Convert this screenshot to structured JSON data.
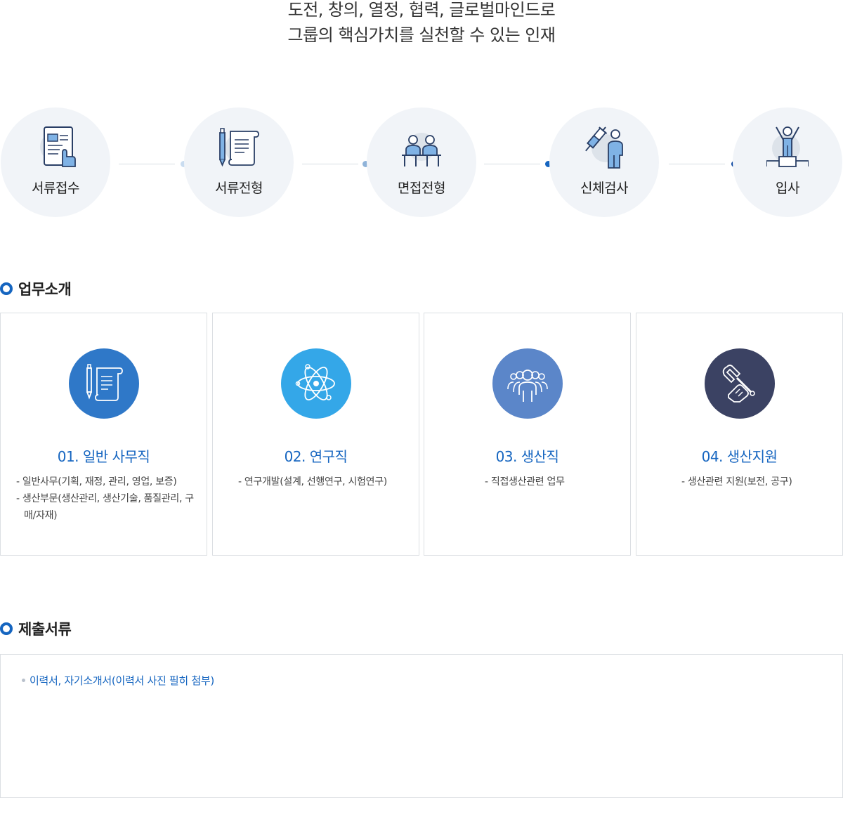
{
  "intro": {
    "line1": "도전, 창의, 열정, 협력, 글로벌마인드로",
    "line2": "그룹의 핵심가치를 실천할 수 있는 인재"
  },
  "process": {
    "steps": [
      {
        "label": "서류접수",
        "icon": "document-touch-icon"
      },
      {
        "label": "서류전형",
        "icon": "pen-scroll-icon"
      },
      {
        "label": "면접전형",
        "icon": "interview-icon"
      },
      {
        "label": "신체검사",
        "icon": "syringe-person-icon"
      },
      {
        "label": "입사",
        "icon": "podium-winner-icon"
      }
    ],
    "colors": {
      "dot1": "#c9dcf0",
      "dot2": "#8fb3d9",
      "dot3": "#1565c0",
      "dot4": "#0d47a1"
    }
  },
  "jobs_section": {
    "title": "업무소개",
    "items": [
      {
        "title": "01. 일반 사무직",
        "icon": "pen-scroll-icon",
        "color": "#2f78c8",
        "lines": [
          "- 일반사무(기획, 재정, 관리, 영업, 보증)",
          "- 생산부문(생산관리, 생산기술, 품질관리, 구매/자재)"
        ]
      },
      {
        "title": "02. 연구직",
        "icon": "atom-icon",
        "color": "#34a7e8",
        "lines": [
          "- 연구개발(설계, 선행연구, 시험연구)"
        ]
      },
      {
        "title": "03. 생산직",
        "icon": "people-group-icon",
        "color": "#5b86c9",
        "lines": [
          "- 직접생산관련 업무"
        ]
      },
      {
        "title": "04. 생산지원",
        "icon": "wrench-hand-icon",
        "color": "#3b4263",
        "lines": [
          "- 생산관련 지원(보전, 공구)"
        ]
      }
    ]
  },
  "docs_section": {
    "title": "제출서류",
    "items": [
      "이력서, 자기소개서(이력서 사진 필히 첨부)"
    ]
  }
}
